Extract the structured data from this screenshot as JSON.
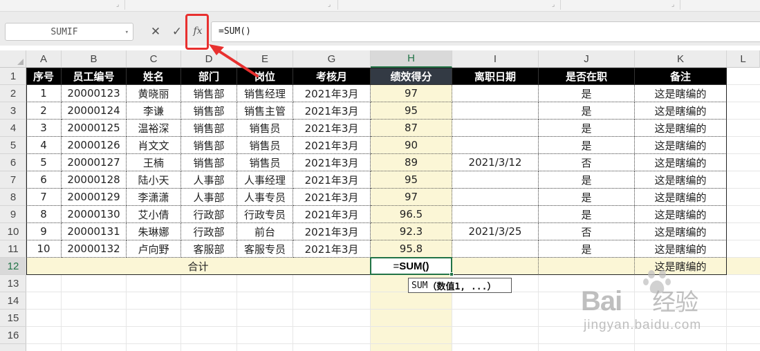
{
  "formula_bar": {
    "name_box": "SUMIF",
    "cancel_icon": "close-icon",
    "enter_icon": "check-icon",
    "fx_label": "fx",
    "formula": "=SUM()"
  },
  "columns": [
    "A",
    "B",
    "C",
    "D",
    "E",
    "G",
    "H",
    "I",
    "J",
    "K",
    "L"
  ],
  "selected_column": "H",
  "row_numbers": [
    "1",
    "2",
    "3",
    "4",
    "5",
    "6",
    "7",
    "8",
    "9",
    "10",
    "11",
    "12",
    "13",
    "14",
    "15",
    "16"
  ],
  "selected_row": "12",
  "table": {
    "headers": [
      "序号",
      "员工编号",
      "姓名",
      "部门",
      "岗位",
      "考核月",
      "绩效得分",
      "离职日期",
      "是否在职",
      "备注"
    ],
    "rows": [
      [
        "1",
        "20000123",
        "黄晓丽",
        "销售部",
        "销售经理",
        "2021年3月",
        "97",
        "",
        "是",
        "这是瞎编的"
      ],
      [
        "2",
        "20000124",
        "李谦",
        "销售部",
        "销售主管",
        "2021年3月",
        "95",
        "",
        "是",
        "这是瞎编的"
      ],
      [
        "3",
        "20000125",
        "温裕深",
        "销售部",
        "销售员",
        "2021年3月",
        "87",
        "",
        "是",
        "这是瞎编的"
      ],
      [
        "4",
        "20000126",
        "肖文文",
        "销售部",
        "销售员",
        "2021年3月",
        "90",
        "",
        "是",
        "这是瞎编的"
      ],
      [
        "5",
        "20000127",
        "王楠",
        "销售部",
        "销售员",
        "2021年3月",
        "89",
        "2021/3/12",
        "否",
        "这是瞎编的"
      ],
      [
        "6",
        "20000128",
        "陆小天",
        "人事部",
        "人事经理",
        "2021年3月",
        "95",
        "",
        "是",
        "这是瞎编的"
      ],
      [
        "7",
        "20000129",
        "李潇潇",
        "人事部",
        "人事专员",
        "2021年3月",
        "97",
        "",
        "是",
        "这是瞎编的"
      ],
      [
        "8",
        "20000130",
        "艾小倩",
        "行政部",
        "行政专员",
        "2021年3月",
        "96.5",
        "",
        "是",
        "这是瞎编的"
      ],
      [
        "9",
        "20000131",
        "朱琳娜",
        "行政部",
        "前台",
        "2021年3月",
        "92.3",
        "2021/3/25",
        "否",
        "这是瞎编的"
      ],
      [
        "10",
        "20000132",
        "卢向野",
        "客服部",
        "客服专员",
        "2021年3月",
        "95.8",
        "",
        "是",
        "这是瞎编的"
      ]
    ],
    "total_label": "合计",
    "total_remark": "这是瞎编的"
  },
  "active_cell": {
    "address": "H12",
    "prefix": "=",
    "function": "SUM",
    "parens": "()"
  },
  "tooltip": {
    "fn": "SUM",
    "args": "（数值1, ...）"
  },
  "watermark": {
    "brand": "Bai",
    "brand_tail": "经验",
    "url": "jingyan.baidu.com"
  },
  "colors": {
    "highlight_column": "#fbf6d6",
    "header_bg": "#000000",
    "accent_green": "#217346",
    "annotation_red": "#e8302f"
  }
}
